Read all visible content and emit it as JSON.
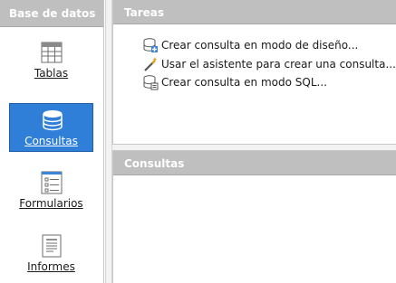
{
  "sidebar": {
    "header": "Base de datos",
    "items": [
      {
        "label": "Tablas",
        "icon": "table-icon",
        "selected": false
      },
      {
        "label": "Consultas",
        "icon": "database-icon",
        "selected": true
      },
      {
        "label": "Formularios",
        "icon": "form-icon",
        "selected": false
      },
      {
        "label": "Informes",
        "icon": "report-icon",
        "selected": false
      }
    ]
  },
  "tasks_panel": {
    "header": "Tareas",
    "tasks": [
      {
        "label": "Crear consulta en modo de diseño...",
        "icon": "query-design-icon"
      },
      {
        "label": "Usar el asistente para crear una consulta...",
        "icon": "wizard-wand-icon"
      },
      {
        "label": "Crear consulta en modo SQL...",
        "icon": "query-sql-icon"
      }
    ]
  },
  "queries_panel": {
    "header": "Consultas"
  },
  "colors": {
    "header_bg": "#bfbfbf",
    "selection": "#2f7fd9"
  }
}
